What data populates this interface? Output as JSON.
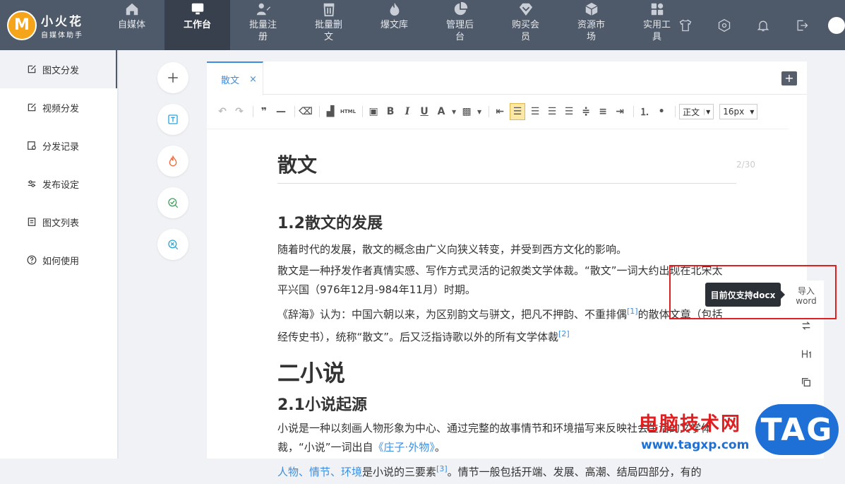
{
  "brand": {
    "name": "小火花",
    "sub": "自媒体助手",
    "logo_letter": "M"
  },
  "nav": [
    {
      "label": "自媒体",
      "icon": "home-icon"
    },
    {
      "label": "工作台",
      "icon": "monitor-icon",
      "active": true
    },
    {
      "label": "批量注册",
      "icon": "edit-user-icon"
    },
    {
      "label": "批量删文",
      "icon": "trash-icon"
    },
    {
      "label": "爆文库",
      "icon": "fire-icon"
    },
    {
      "label": "管理后台",
      "icon": "pie-chart-icon"
    },
    {
      "label": "购买会员",
      "icon": "diamond-icon"
    },
    {
      "label": "资源市场",
      "icon": "box-icon"
    },
    {
      "label": "实用工具",
      "icon": "apps-icon"
    }
  ],
  "sidebar": {
    "items": [
      {
        "label": "图文分发",
        "icon": "share-edit-icon",
        "active": true
      },
      {
        "label": "视频分发",
        "icon": "video-share-icon"
      },
      {
        "label": "分发记录",
        "icon": "record-icon"
      },
      {
        "label": "发布设定",
        "icon": "settings-sliders-icon"
      },
      {
        "label": "图文列表",
        "icon": "list-doc-icon"
      },
      {
        "label": "如何使用",
        "icon": "help-icon"
      }
    ]
  },
  "editor": {
    "tab_label": "散文",
    "tab_close": "×",
    "add_tab": "+",
    "paragraph_style": "正文",
    "font_size": "16px",
    "html_label": "HTML",
    "bold": "B",
    "italic": "I",
    "underline": "U",
    "font_color": "A"
  },
  "doc": {
    "title": "散文",
    "counter": "2/30",
    "h_1_2": "1.2散文的发展",
    "p1": "随着时代的发展，散文的概念由广义向狭义转变，并受到西方文化的影响。",
    "p2": "散文是一种抒发作者真情实感、写作方式灵活的记叙类文学体裁。“散文”一词大约出现在北宋太平兴国（976年12月-984年11月）时期。",
    "p3_a": "《辞海》认为：中国六朝以来，为区别韵文与骈文，把凡不押韵、不重排偶",
    "p3_sup1": "[1]",
    "p3_b": "的散体文章（包括经传史书），统称“散文”。后又泛指诗歌以外的所有文学体裁",
    "p3_sup2": "[2]",
    "h_2": "二小说",
    "h_2_1": "2.1小说起源",
    "p4_a": "小说是一种以刻画人物形象为中心、通过完整的故事情节和环境描写来反映社会生活的文学体裁，“小说”一词出自",
    "p4_link": "《庄子·外物》",
    "p4_b": "。",
    "p5_links": "人物、情节、环境",
    "p5_text": "是小说的三要素",
    "p5_sup": "[3]",
    "p5_tail": "。情节一般包括开端、发展、高潮、结局四部分，有的"
  },
  "tooltip": "目前仅支持docx",
  "import_word": {
    "line1": "导入",
    "line2": "word"
  },
  "watermark": {
    "site": "电脑技术网",
    "url": "www.tagxp.com",
    "tag": "TAG"
  }
}
